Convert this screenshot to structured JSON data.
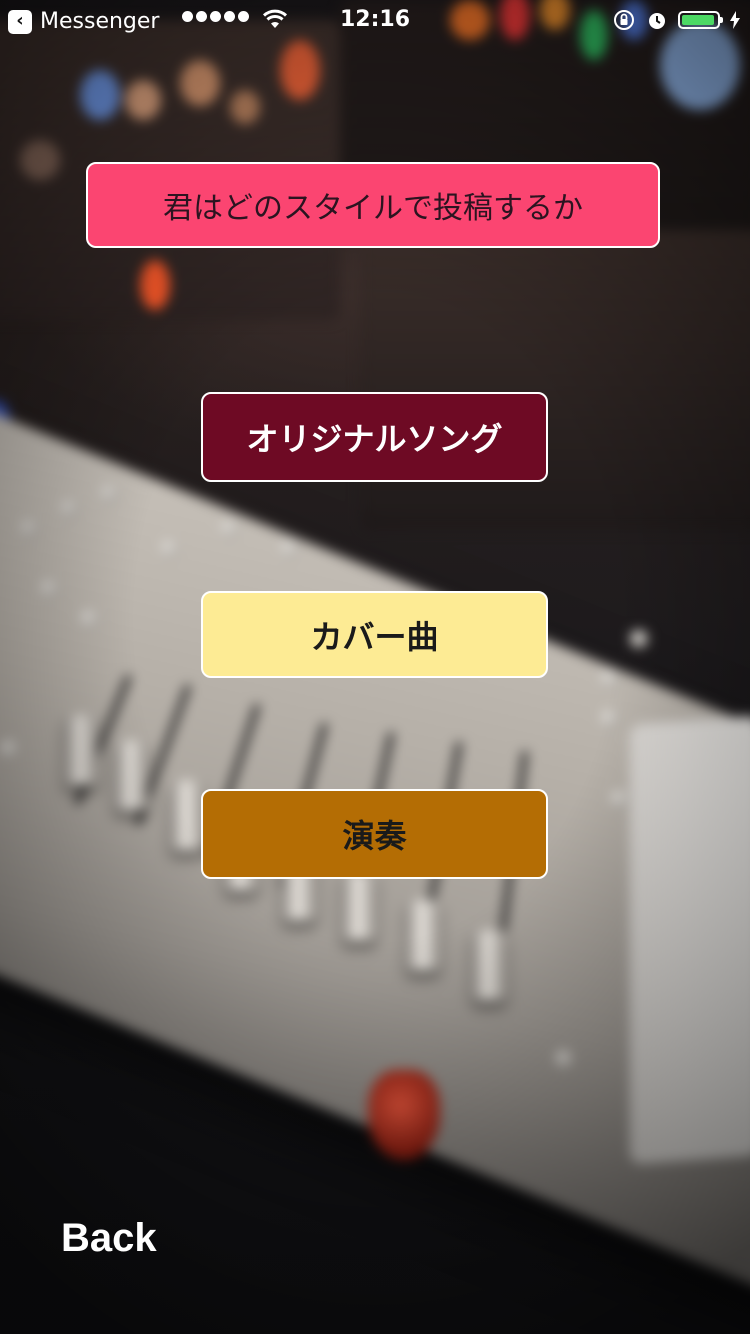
{
  "status_bar": {
    "back_app_label": "Messenger",
    "time": "12:16",
    "signal_icon": "signal-dots-icon",
    "wifi_icon": "wifi-icon",
    "battery_color": "#4cd964",
    "battery_level": 0.95
  },
  "header": {
    "title": "君はどのスタイルで投稿するか",
    "background": "#fb4571"
  },
  "choices": [
    {
      "label": "オリジナルソング",
      "background": "#6e0a24",
      "text_color": "#ffffff"
    },
    {
      "label": "カバー曲",
      "background": "#fdeb94",
      "text_color": "#1a1a1a"
    },
    {
      "label": "演奏",
      "background": "#b46d04",
      "text_color": "#1a1a1a"
    }
  ],
  "footer": {
    "back_label": "Back"
  }
}
